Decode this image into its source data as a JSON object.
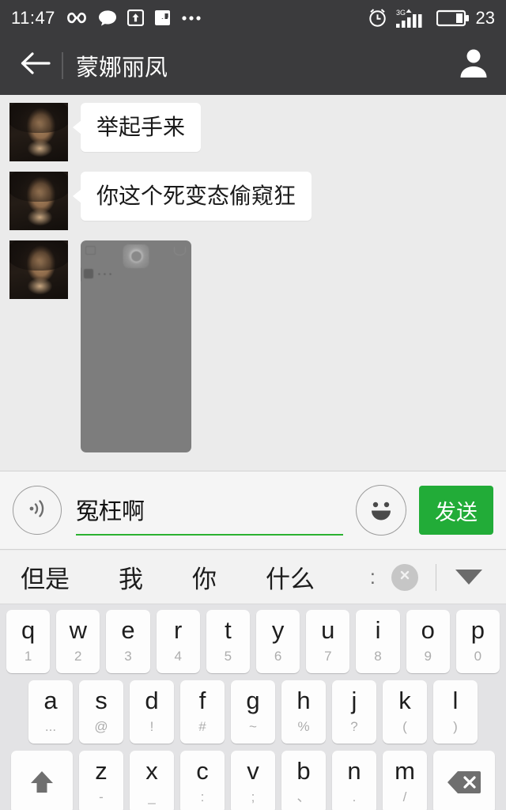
{
  "status_bar": {
    "time": "11:47",
    "battery_percent": "23",
    "network": "3G",
    "icons": [
      "infinity-icon",
      "chat-bubble-icon",
      "upload-icon",
      "flag-icon",
      "more-dots-icon",
      "alarm-clock-icon",
      "signal-bars-icon",
      "battery-icon"
    ]
  },
  "header": {
    "title": "蒙娜丽凤",
    "back_icon": "back-arrow-icon",
    "profile_icon": "contact-profile-icon"
  },
  "chat": {
    "messages": [
      {
        "type": "text",
        "sender": "them",
        "text": "举起手来",
        "avatar": "contact-photo"
      },
      {
        "type": "text",
        "sender": "them",
        "text": "你这个死变态偷窥狂",
        "avatar": "contact-photo"
      },
      {
        "type": "image",
        "sender": "them",
        "avatar": "contact-photo",
        "caption": ""
      }
    ]
  },
  "input_bar": {
    "voice_icon": "voice-input-icon",
    "text_value": "冤枉啊",
    "placeholder": "",
    "emoji_icon": "emoji-smiley-icon",
    "send_label": "发送",
    "send_color": "#22ac38",
    "underline_color": "#2bb231"
  },
  "keyboard": {
    "suggestions": [
      "但是",
      "我",
      "你",
      "什么"
    ],
    "colon_label": ":",
    "clear_icon": "clear-x-icon",
    "hide_icon": "hide-keyboard-caret-icon",
    "rows": [
      [
        {
          "main": "q",
          "sub": "1"
        },
        {
          "main": "w",
          "sub": "2"
        },
        {
          "main": "e",
          "sub": "3"
        },
        {
          "main": "r",
          "sub": "4"
        },
        {
          "main": "t",
          "sub": "5"
        },
        {
          "main": "y",
          "sub": "6"
        },
        {
          "main": "u",
          "sub": "7"
        },
        {
          "main": "i",
          "sub": "8"
        },
        {
          "main": "o",
          "sub": "9"
        },
        {
          "main": "p",
          "sub": "0"
        }
      ],
      [
        {
          "main": "a",
          "sub": "..."
        },
        {
          "main": "s",
          "sub": "@"
        },
        {
          "main": "d",
          "sub": "!"
        },
        {
          "main": "f",
          "sub": "#"
        },
        {
          "main": "g",
          "sub": "~"
        },
        {
          "main": "h",
          "sub": "%"
        },
        {
          "main": "j",
          "sub": "?"
        },
        {
          "main": "k",
          "sub": "("
        },
        {
          "main": "l",
          "sub": ")"
        }
      ],
      [
        {
          "main": "",
          "sub": "",
          "icon": "shift-icon"
        },
        {
          "main": "z",
          "sub": "-"
        },
        {
          "main": "x",
          "sub": "_"
        },
        {
          "main": "c",
          "sub": ":"
        },
        {
          "main": "v",
          "sub": ";"
        },
        {
          "main": "b",
          "sub": "、"
        },
        {
          "main": "n",
          "sub": "."
        },
        {
          "main": "m",
          "sub": "/"
        },
        {
          "main": "",
          "sub": "",
          "icon": "backspace-icon"
        }
      ]
    ]
  },
  "colors": {
    "status_bg": "#3b3b3d",
    "header_bg": "#3b3b3d",
    "chat_bg": "#ebebeb",
    "bubble_bg": "#ffffff",
    "keyboard_bg": "#e3e3e5",
    "key_bg": "#fdfdfd",
    "accent_green": "#22ac38"
  }
}
